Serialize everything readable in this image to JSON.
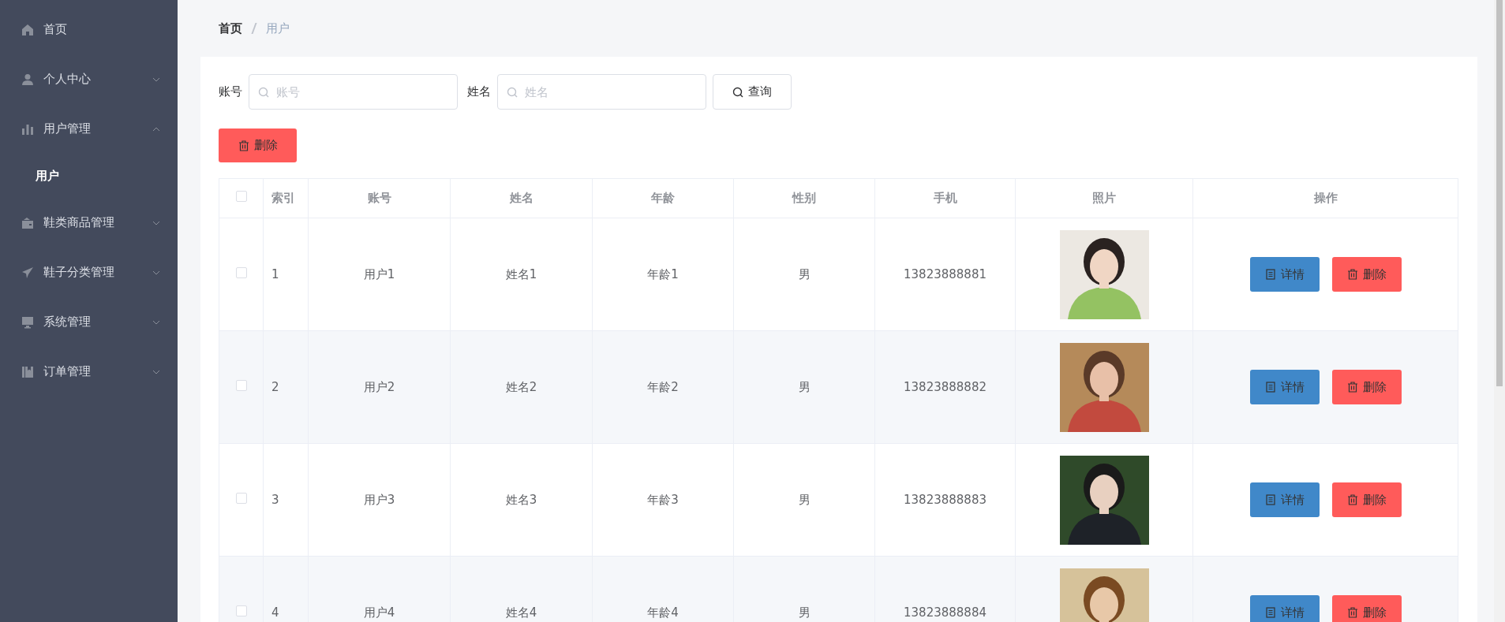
{
  "sidebar": {
    "items": [
      {
        "label": "首页",
        "kind": "link"
      },
      {
        "label": "个人中心",
        "kind": "submenu",
        "expanded": false
      },
      {
        "label": "用户管理",
        "kind": "submenu",
        "expanded": true,
        "children": [
          {
            "label": "用户",
            "selected": true
          }
        ]
      },
      {
        "label": "鞋类商品管理",
        "kind": "submenu",
        "expanded": false
      },
      {
        "label": "鞋子分类管理",
        "kind": "submenu",
        "expanded": false
      },
      {
        "label": "系统管理",
        "kind": "submenu",
        "expanded": false
      },
      {
        "label": "订单管理",
        "kind": "submenu",
        "expanded": false
      }
    ]
  },
  "breadcrumb": [
    {
      "label": "首页"
    },
    {
      "label": "用户"
    }
  ],
  "search": {
    "fields": [
      {
        "label": "账号",
        "placeholder": "账号"
      },
      {
        "label": "姓名",
        "placeholder": "姓名"
      }
    ],
    "button": "查询"
  },
  "toolbar": {
    "delete_button": "删除"
  },
  "table": {
    "select_all": {
      "checked": false
    },
    "columns": [
      "索引",
      "账号",
      "姓名",
      "年龄",
      "性别",
      "手机",
      "照片",
      "操作"
    ],
    "rows": [
      {
        "checked": false,
        "index": "1",
        "account": "用户1",
        "name": "姓名1",
        "age": "年龄1",
        "gender": "男",
        "phone": "13823888881",
        "actions": [
          "详情",
          "删除"
        ]
      },
      {
        "checked": false,
        "index": "2",
        "account": "用户2",
        "name": "姓名2",
        "age": "年龄2",
        "gender": "男",
        "phone": "13823888882",
        "actions": [
          "详情",
          "删除"
        ]
      },
      {
        "checked": false,
        "index": "3",
        "account": "用户3",
        "name": "姓名3",
        "age": "年龄3",
        "gender": "男",
        "phone": "13823888883",
        "actions": [
          "详情",
          "删除"
        ]
      },
      {
        "checked": false,
        "index": "4",
        "account": "用户4",
        "name": "姓名4",
        "age": "年龄4",
        "gender": "男",
        "phone": "13823888884",
        "actions": [
          "详情",
          "删除"
        ]
      }
    ]
  }
}
